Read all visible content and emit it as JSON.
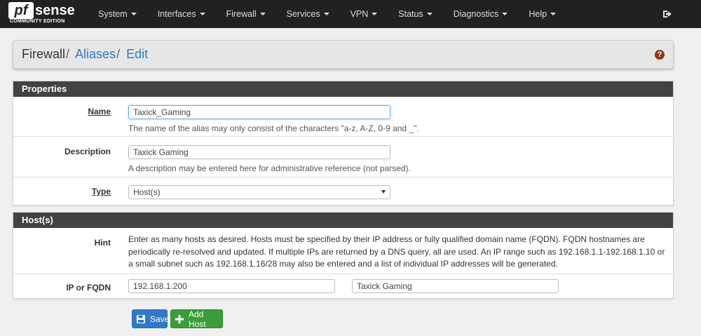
{
  "nav": {
    "logo_pf": "pf",
    "logo_sense": "sense",
    "logo_edition": "COMMUNITY EDITION",
    "items": [
      "System",
      "Interfaces",
      "Firewall",
      "Services",
      "VPN",
      "Status",
      "Diagnostics",
      "Help"
    ]
  },
  "breadcrumb": {
    "root": "Firewall",
    "sep1": "/",
    "link1": "Aliases",
    "sep2": "/",
    "link2": "Edit"
  },
  "properties": {
    "heading": "Properties",
    "name_label": "Name",
    "name_value": "Taxick_Gaming",
    "name_help": "The name of the alias may only consist of the characters \"a-z, A-Z, 0-9 and _\".",
    "description_label": "Description",
    "description_value": "Taxick Gaming",
    "description_help": "A description may be entered here for administrative reference (not parsed).",
    "type_label": "Type",
    "type_value": "Host(s)"
  },
  "hosts": {
    "heading": "Host(s)",
    "hint_label": "Hint",
    "hint_text": "Enter as many hosts as desired. Hosts must be specified by their IP address or fully qualified domain name (FQDN). FQDN hostnames are periodically re-resolved and updated. If multiple IPs are returned by a DNS query, all are used. An IP range such as 192.168.1.1-192.168.1.10 or a small subnet such as 192.168.1.16/28 may also be entered and a list of individual IP addresses will be generated.",
    "ip_label": "IP or FQDN",
    "ip_value": "192.168.1.200",
    "ip_description_value": "Taxick Gaming"
  },
  "buttons": {
    "save": "Save",
    "add_host": "Add Host"
  },
  "colors": {
    "navbar": "#212121",
    "panel_heading": "#424242",
    "link": "#3179c7",
    "save_button": "#3179c7",
    "add_button": "#3a9d3a"
  },
  "icons": {
    "logout": "sign-out-icon",
    "help": "question-circle-icon",
    "save": "floppy-disk-icon",
    "add": "plus-icon"
  }
}
